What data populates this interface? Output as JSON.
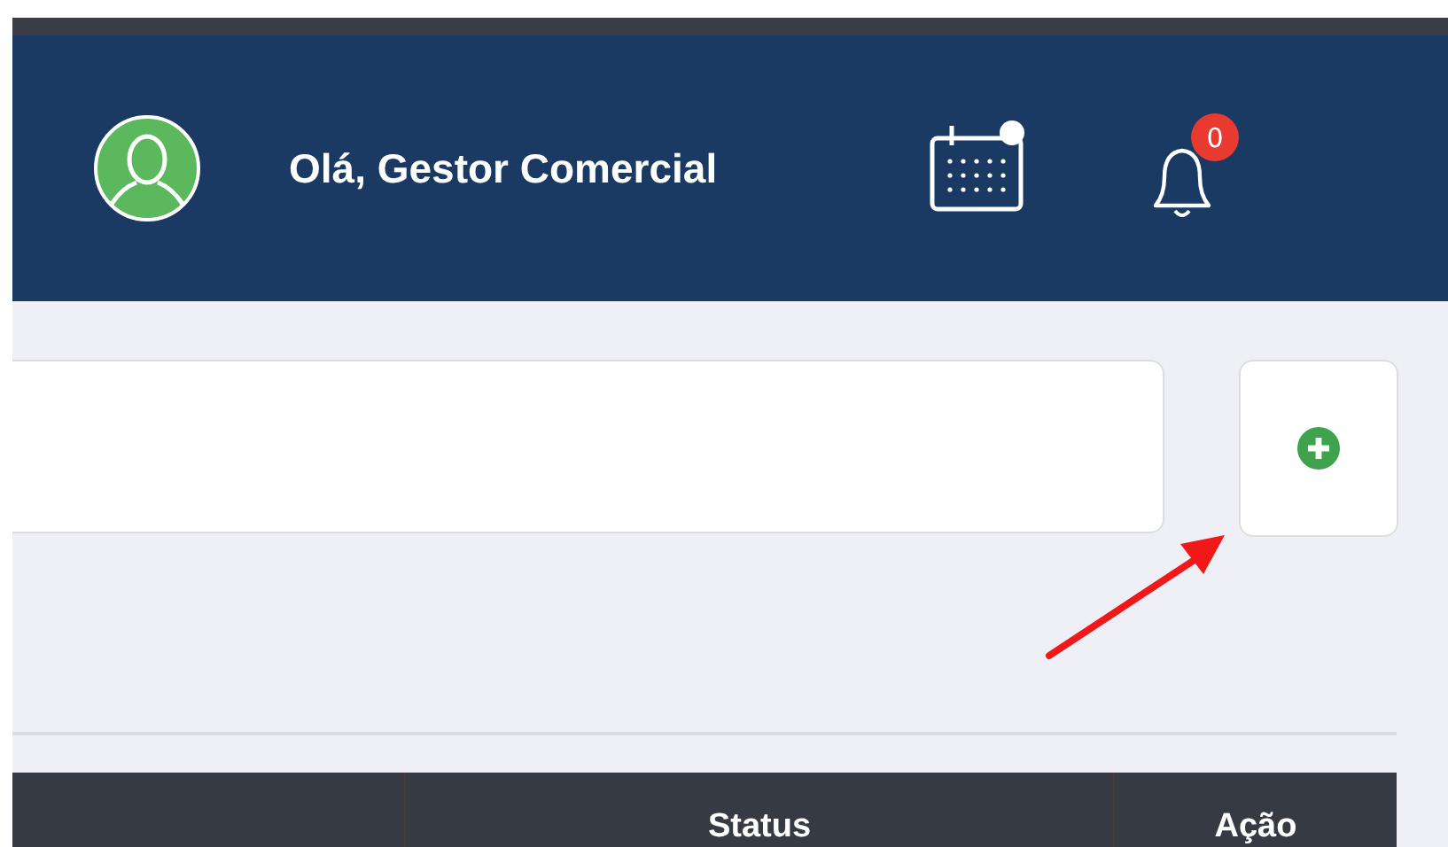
{
  "header": {
    "greeting": "Olá, Gestor Comercial",
    "notification_count": "0"
  },
  "table": {
    "columns": [
      {
        "label": "Status"
      },
      {
        "label": "Ação"
      }
    ]
  }
}
